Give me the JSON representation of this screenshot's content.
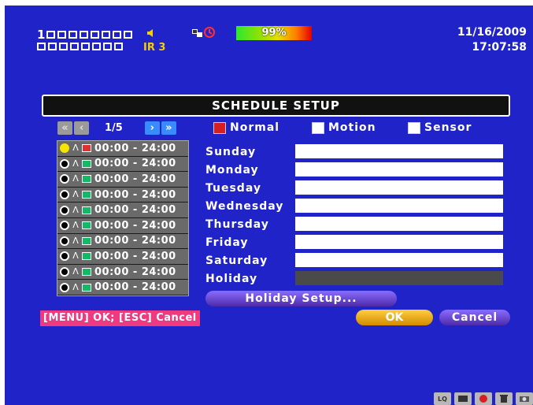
{
  "status": {
    "channel_row1_number": "1",
    "ir_label": "IR 3",
    "hdd_percent": "99%",
    "date": "11/16/2009",
    "time": "17:07:58"
  },
  "dialog": {
    "title": "SCHEDULE SETUP",
    "pager": {
      "page": "1/5",
      "first_icon": "double-left-arrow",
      "prev_icon": "left-arrow",
      "next_icon": "right-arrow",
      "last_icon": "double-right-arrow"
    },
    "legend": [
      {
        "label": "Normal",
        "color": "#d42020",
        "checked": true
      },
      {
        "label": "Motion",
        "color": "#ffffff",
        "checked": false
      },
      {
        "label": "Sensor",
        "color": "#ffffff",
        "checked": false
      }
    ],
    "schedules": [
      {
        "time": "00:00 - 24:00",
        "selected": true
      },
      {
        "time": "00:00 - 24:00",
        "selected": false
      },
      {
        "time": "00:00 - 24:00",
        "selected": false
      },
      {
        "time": "00:00 - 24:00",
        "selected": false
      },
      {
        "time": "00:00 - 24:00",
        "selected": false
      },
      {
        "time": "00:00 - 24:00",
        "selected": false
      },
      {
        "time": "00:00 - 24:00",
        "selected": false
      },
      {
        "time": "00:00 - 24:00",
        "selected": false
      },
      {
        "time": "00:00 - 24:00",
        "selected": false
      },
      {
        "time": "00:00 - 24:00",
        "selected": false
      }
    ],
    "days": [
      "Sunday",
      "Monday",
      "Tuesday",
      "Wednesday",
      "Thursday",
      "Friday",
      "Saturday",
      "Holiday"
    ],
    "holiday_button": "Holiday Setup...",
    "menu_hint": "[MENU] OK; [ESC] Cancel",
    "ok_label": "OK",
    "cancel_label": "Cancel"
  },
  "bottom_icons": [
    "LQ",
    "record-icon",
    "alarm-icon",
    "trash-icon",
    "camera-icon"
  ],
  "colors": {
    "background": "#1f23c8",
    "hdd_start": "#2ee82e",
    "hdd_end": "#e00000"
  }
}
